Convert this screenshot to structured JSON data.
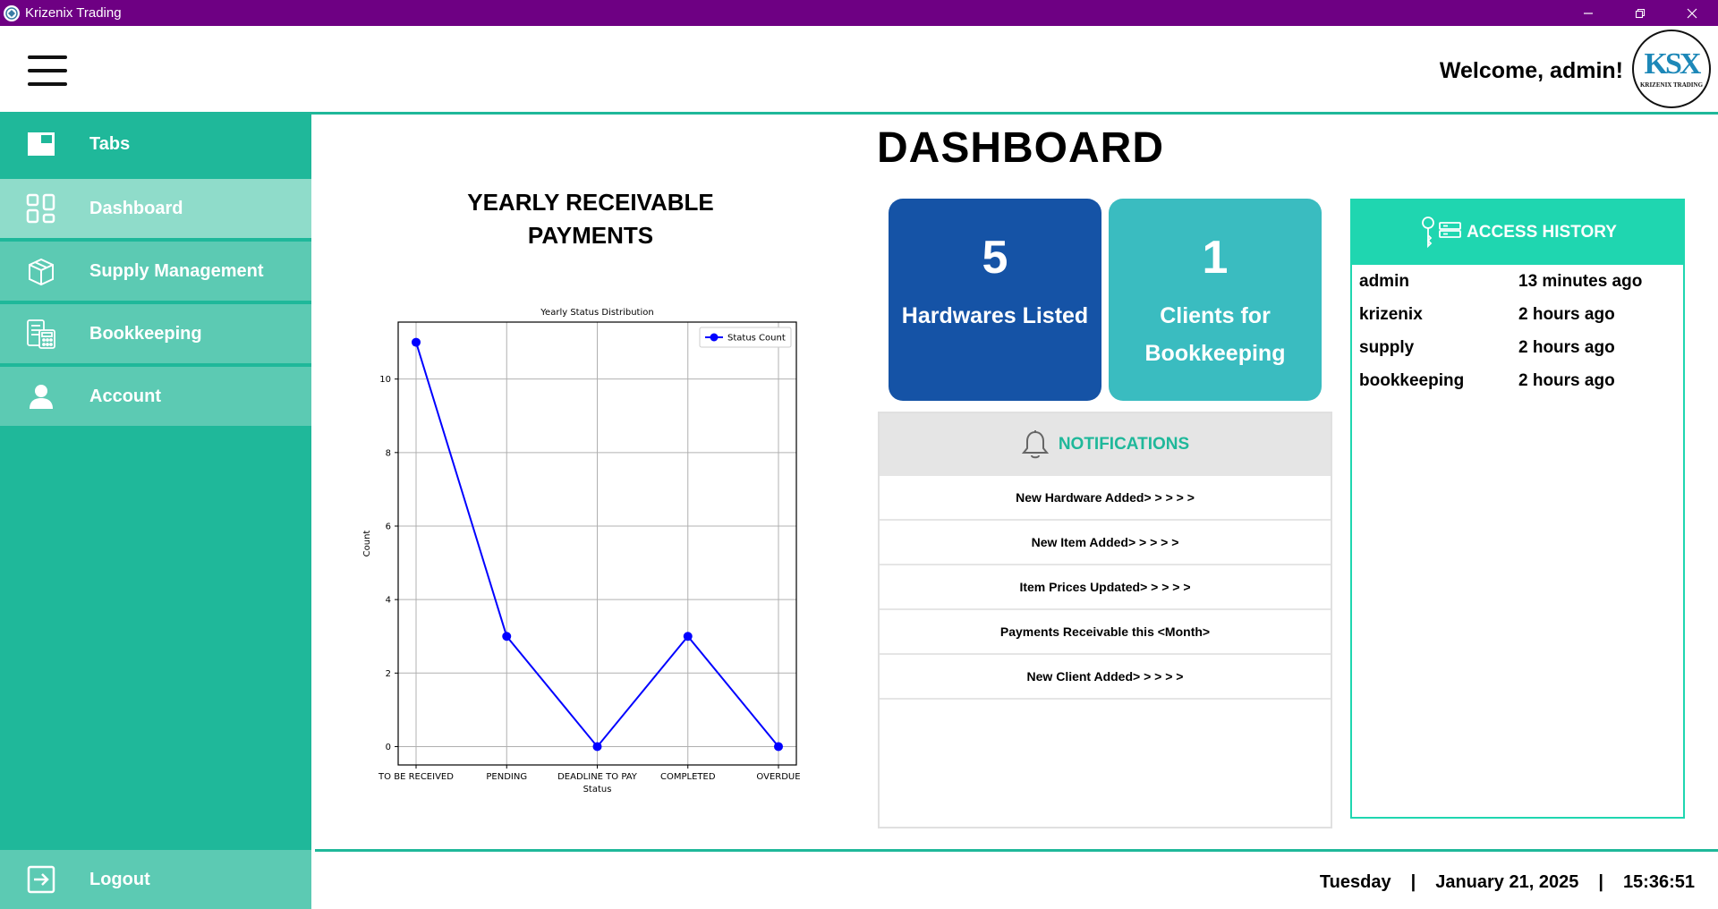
{
  "window": {
    "title": "Krizenix Trading",
    "controls": {
      "minimize": "—",
      "restore": "❐",
      "close": "✕"
    }
  },
  "header": {
    "welcome": "Welcome, admin!",
    "logo_mark": "KSX",
    "logo_text": "KRIZENIX TRADING"
  },
  "sidebar": {
    "items": [
      {
        "label": "Tabs",
        "icon": "tabs-icon"
      },
      {
        "label": "Dashboard",
        "icon": "dashboard-grid-icon"
      },
      {
        "label": "Supply Management",
        "icon": "box-icon"
      },
      {
        "label": "Bookkeeping",
        "icon": "ledger-calculator-icon"
      },
      {
        "label": "Account",
        "icon": "user-icon"
      }
    ],
    "logout": {
      "label": "Logout",
      "icon": "logout-icon"
    },
    "active": "Dashboard"
  },
  "main": {
    "title": "DASHBOARD",
    "chart_heading": "YEARLY RECEIVABLE PAYMENTS"
  },
  "chart_data": {
    "type": "line",
    "title": "Yearly Status Distribution",
    "xlabel": "Status",
    "ylabel": "Count",
    "categories": [
      "TO BE RECEIVED",
      "PENDING",
      "DEADLINE TO PAY",
      "COMPLETED",
      "OVERDUE"
    ],
    "series": [
      {
        "name": "Status Count",
        "values": [
          11,
          3,
          0,
          3,
          0
        ],
        "color": "#0000ff"
      }
    ],
    "ylim": [
      -0.5,
      11.55
    ],
    "yticks": [
      0,
      2,
      4,
      6,
      8,
      10
    ],
    "grid": true,
    "legend": "top-right"
  },
  "stats": {
    "hardwares": {
      "value": "5",
      "label": "Hardwares Listed",
      "color": "#1553a6"
    },
    "clients": {
      "value": "1",
      "label": "Clients for Bookkeeping",
      "color": "#3abcc0"
    }
  },
  "notifications": {
    "heading": "NOTIFICATIONS",
    "icon": "bell-icon",
    "items": [
      "New Hardware Added> > > > >",
      "New Item Added> > > > >",
      "Item Prices Updated> > > > >",
      "Payments Receivable this <Month>",
      "New Client Added> > > > >"
    ]
  },
  "access_history": {
    "heading": "ACCESS HISTORY",
    "icon": "key-server-icon",
    "rows": [
      {
        "user": "admin",
        "time": "13 minutes ago"
      },
      {
        "user": "krizenix",
        "time": "2 hours ago"
      },
      {
        "user": "supply",
        "time": "2 hours ago"
      },
      {
        "user": "bookkeeping",
        "time": "2 hours ago"
      }
    ]
  },
  "footer": {
    "day": "Tuesday",
    "date": "January 21, 2025",
    "time": "15:36:51",
    "separator": "|"
  },
  "colors": {
    "titlebar": "#6e0083",
    "accent": "#1fb89a",
    "sidebar_active": "#8fdcca",
    "sidebar_item": "#5ccab3",
    "access_accent": "#1fd6b0"
  }
}
